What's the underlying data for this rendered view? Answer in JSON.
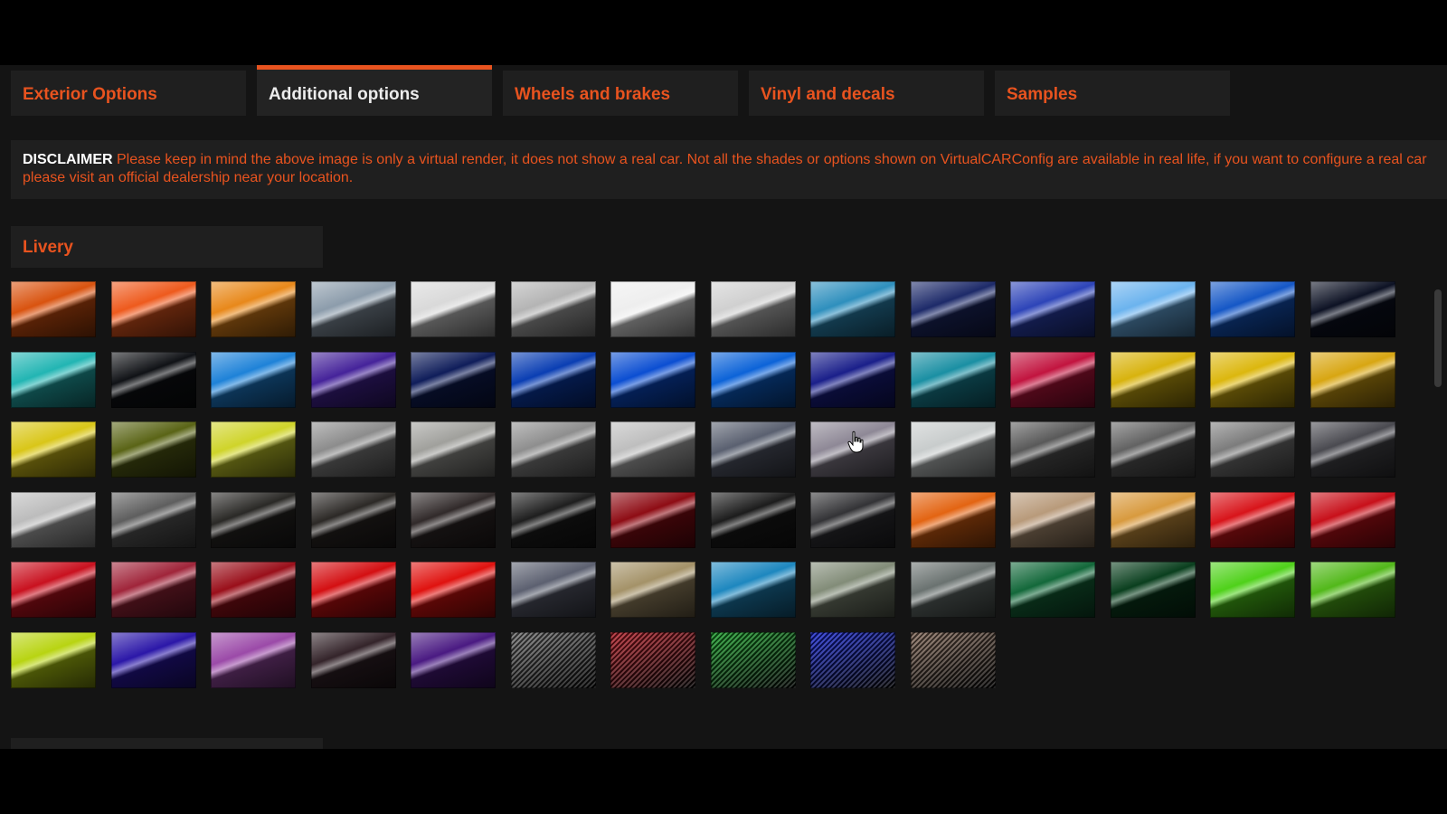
{
  "tabs": [
    {
      "label": "Exterior Options",
      "active": false
    },
    {
      "label": "Additional options",
      "active": true
    },
    {
      "label": "Wheels and brakes",
      "active": false
    },
    {
      "label": "Vinyl and decals",
      "active": false
    },
    {
      "label": "Samples",
      "active": false
    }
  ],
  "disclaimer": {
    "lead": "DISCLAIMER",
    "text": " Please keep in mind the above image is only a virtual render, it does not show a real car. Not all the shades or options shown on VirtualCARConfig are available in real life, if you want to configure a real car please visit an official dealership near your location."
  },
  "livery": {
    "title": "Livery",
    "rows": [
      [
        "#d9530f",
        "#ee5a1d",
        "#e8881a",
        "#8c9cab",
        "#d9d9d9",
        "#b4b4b4",
        "#eeeeee",
        "#d0d0d0",
        "#2e8fbd",
        "#1d2a69",
        "#2d44b8",
        "#6bb3ee",
        "#1557c6",
        "#0d1224"
      ],
      [
        "#22b5b3",
        "#101216",
        "#1e82d8",
        "#45239a",
        "#0f1d5a",
        "#0a3eb3",
        "#0b4ed2",
        "#0c63d8",
        "#1a1f8a",
        "#1a8fa3",
        "#c2143f",
        "#d8b30e",
        "#dcb70e",
        "#d8a612"
      ],
      [
        "#d9c618",
        "#5a6416",
        "#cfd42a",
        "#8c8c8c",
        "#a0a09c",
        "#8e8e8e",
        "#bebebe",
        "#5a6070",
        "#8e8896",
        "#c8cccc",
        "#595959",
        "#626262",
        "#7c7c7c",
        "#4a4a50"
      ],
      [
        "#bcbcbc",
        "#5e5e5e",
        "#2a2926",
        "#2c2926",
        "#312a2a",
        "#1e1e1e",
        "#8e0c14",
        "#1c1c1c",
        "#333336",
        "#e36412",
        "#b89a7a",
        "#d89a3e",
        "#d8141a",
        "#c8101a"
      ],
      [
        "#c9111f",
        "#a0253a",
        "#9a0f1a",
        "#d40f12",
        "#e0120f",
        "#5c6070",
        "#a49268",
        "#1d87bf",
        "#828c78",
        "#6a7270",
        "#13683a",
        "#0a3f1e",
        "#4fd11a",
        "#52b81a"
      ],
      [
        "#b8d412",
        "#2b17a8",
        "#9b4aa8",
        "#34242a",
        "#4a1a82",
        "carbon:#777777",
        "carbon:#b8202a",
        "carbon:#1aa02a",
        "carbon:#1a2ad8",
        "carbon:#8a7060"
      ]
    ]
  },
  "icons": {
    "pointer": "hand-pointer-icon"
  },
  "colors": {
    "accent": "#e8531f",
    "panel": "#1f1f1f",
    "background": "#141414"
  }
}
